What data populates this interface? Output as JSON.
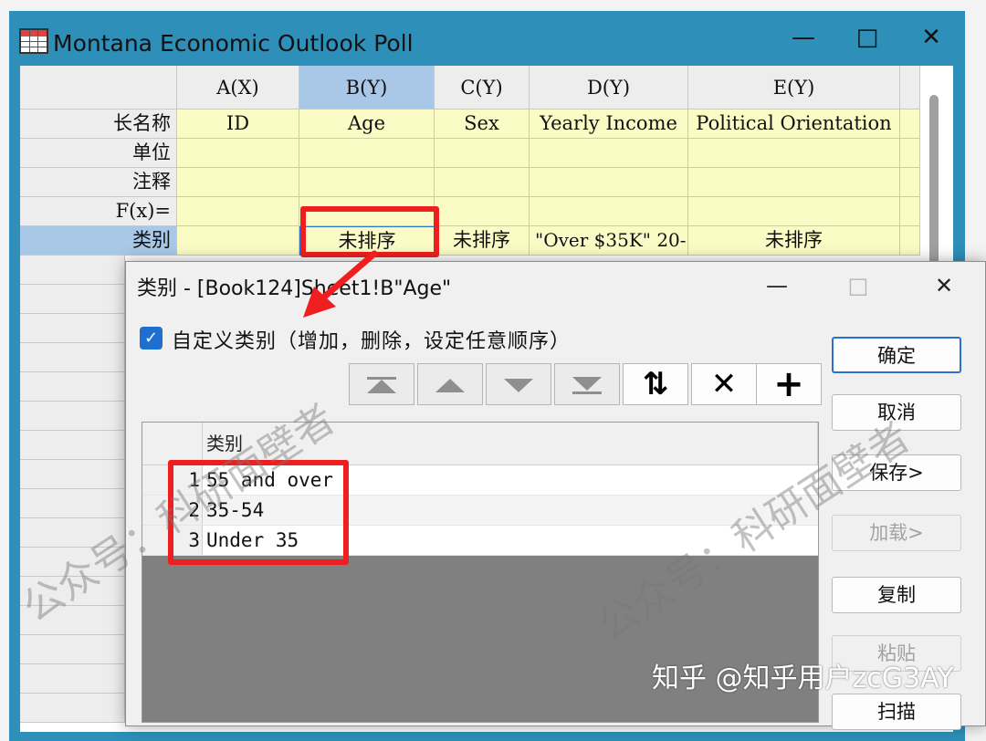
{
  "workbook": {
    "title": "Montana Economic Outlook Poll",
    "controls": {
      "minimize": "—",
      "maximize": "□",
      "close": "✕"
    },
    "columns": [
      "A(X)",
      "B(Y)",
      "C(Y)",
      "D(Y)",
      "E(Y)"
    ],
    "row_labels": [
      "长名称",
      "单位",
      "注释",
      "F(x)=",
      "类别"
    ],
    "long_names": [
      "ID",
      "Age",
      "Sex",
      "Yearly Income",
      "Political Orientation"
    ],
    "category_row": [
      "",
      "未排序",
      "未排序",
      "\"Over $35K\" 20-",
      "未排序"
    ]
  },
  "dialog": {
    "title": "类别 - [Book124]Sheet1!B\"Age\"",
    "checkbox": {
      "checked": true,
      "label": "自定义类别（增加，删除，设定任意顺序）"
    },
    "toolbar": [
      {
        "name": "move-top",
        "icon": "move-to-top-icon",
        "enabled": false
      },
      {
        "name": "move-up",
        "icon": "move-up-icon",
        "enabled": false
      },
      {
        "name": "move-down",
        "icon": "move-down-icon",
        "enabled": false
      },
      {
        "name": "move-bottom",
        "icon": "move-to-bottom-icon",
        "enabled": false
      },
      {
        "name": "sort",
        "icon": "sort-icon",
        "symbol": "⇅",
        "enabled": true
      },
      {
        "name": "delete",
        "icon": "delete-icon",
        "symbol": "✕",
        "enabled": true
      },
      {
        "name": "add",
        "icon": "add-icon",
        "symbol": "+",
        "enabled": true
      }
    ],
    "list": {
      "header": "类别",
      "rows": [
        {
          "index": "1",
          "value": "55 and over"
        },
        {
          "index": "2",
          "value": "35-54"
        },
        {
          "index": "3",
          "value": "Under 35"
        }
      ]
    },
    "buttons": {
      "ok": "确定",
      "cancel": "取消",
      "save": "保存>",
      "load": "加载>",
      "copy": "复制",
      "paste": "粘贴",
      "scan": "扫描"
    }
  },
  "watermarks": {
    "account": "公众号：科研面壁者",
    "zhihu": "知乎 @知乎用户zcG3AY"
  },
  "colors": {
    "highlight": "#f01f1f",
    "title_bar": "#2e8fb8",
    "checkbox": "#1f6fd1"
  }
}
